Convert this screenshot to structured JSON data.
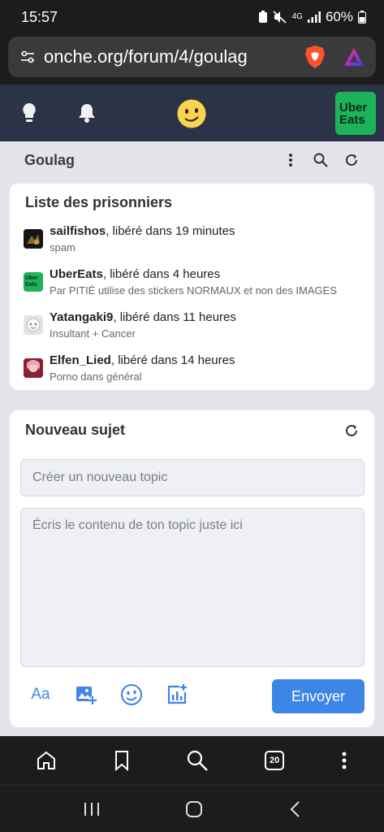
{
  "status": {
    "time": "15:57",
    "network": "4G",
    "battery": "60%"
  },
  "browser": {
    "url": "onche.org/forum/4/goulag",
    "tab_count": "20"
  },
  "header": {
    "ubereats_line1": "Uber",
    "ubereats_line2": "Eats"
  },
  "forum": {
    "title": "Goulag"
  },
  "prisoners": {
    "title": "Liste des prisonniers",
    "items": [
      {
        "name": "sailfishos",
        "status": ", libéré dans 19 minutes",
        "reason": "spam",
        "avatar": "dark-image"
      },
      {
        "name": "UberEats",
        "status": ", libéré dans 4 heures",
        "reason": "Par PITIÉ utilise des stickers NORMAUX et non des IMAGES",
        "avatar": "ubereats-logo",
        "avatar_line1": "Uber",
        "avatar_line2": "Eats"
      },
      {
        "name": "Yatangaki9",
        "status": ", libéré dans 11 heures",
        "reason": "Insultant + Cancer",
        "avatar": "default-face"
      },
      {
        "name": "Elfen_Lied",
        "status": ", libéré dans 14 heures",
        "reason": "Porno dans général",
        "avatar": "anime-image"
      }
    ]
  },
  "new_topic": {
    "title": "Nouveau sujet",
    "title_placeholder": "Créer un nouveau topic",
    "content_placeholder": "Écris le contenu de ton topic juste ici",
    "font_tool": "Aa",
    "send_label": "Envoyer"
  },
  "colors": {
    "accent": "#3d86e8",
    "header_bg": "#2b3346",
    "ubereats": "#1eb35a",
    "brave": "#fb542b"
  }
}
